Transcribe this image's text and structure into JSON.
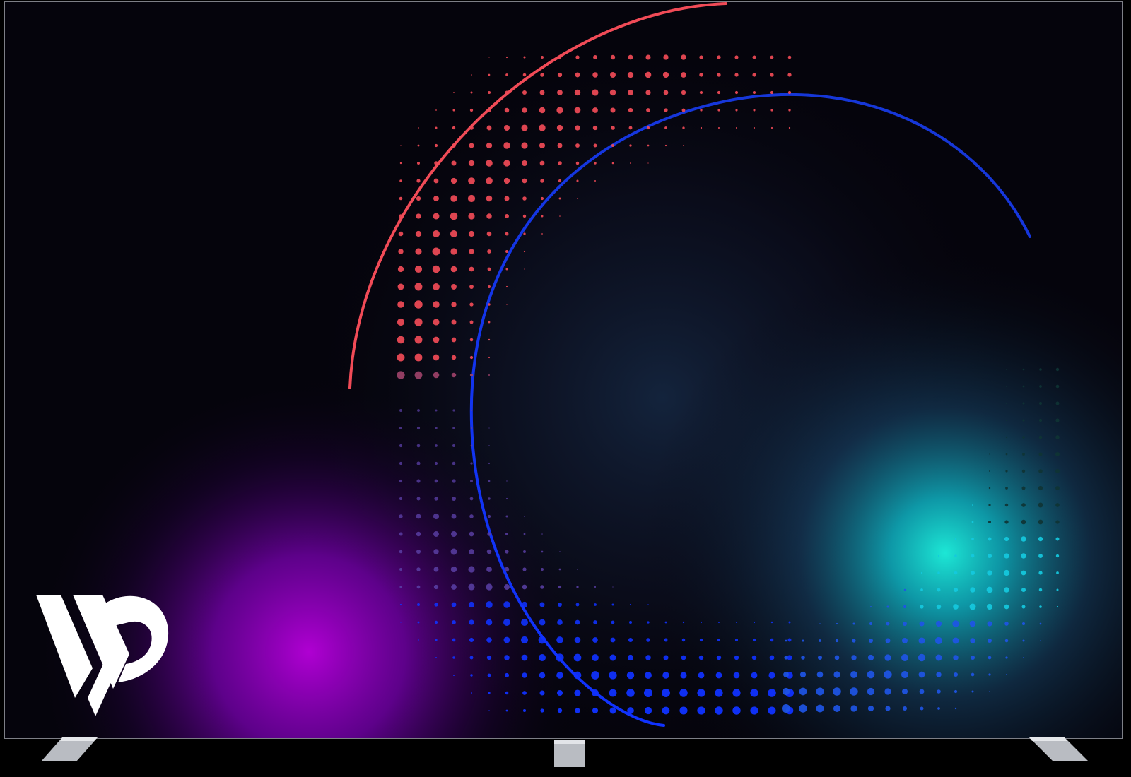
{
  "display": {
    "frame_color": "#7d7f86",
    "feet_color": "#b9bcc2",
    "screen": {
      "background_colors": {
        "dark": "#05040c",
        "purple": "#b300d6",
        "teal": "#1ef3e0",
        "red": "#f14b57",
        "blue": "#1032ff"
      }
    }
  },
  "graphic": {
    "logo_icon": "vp-logo-icon",
    "logo_text": "VP",
    "logo_color": "#ffffff"
  }
}
